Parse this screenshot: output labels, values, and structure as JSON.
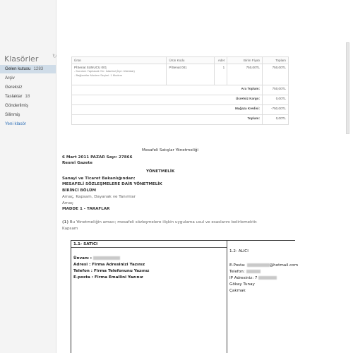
{
  "sidebar": {
    "title": "Klasörler",
    "refresh_icon": "refresh-icon",
    "folders": [
      {
        "label": "Gelen kutusu",
        "count": "1283",
        "selected": true
      },
      {
        "label": "Arşiv",
        "count": ""
      },
      {
        "label": "Gereksiz",
        "count": ""
      },
      {
        "label": "Taslaklar",
        "count": "18"
      },
      {
        "label": "Gönderilmiş",
        "count": ""
      },
      {
        "label": "Silinmiş",
        "count": ""
      }
    ],
    "new_folder": "Yeni klasör"
  },
  "order": {
    "headers": [
      "Ürün",
      "Ürün Kodu",
      "Adet",
      "Birim Fiyatı",
      "Toplam"
    ],
    "row": {
      "product": "PİSenat SUNUCU 001",
      "notes": [
        "- Kurulum Yapılacak Yer: İstanbul (İlçe: Üsküdar)",
        "- Bağlantılar Modem Seçimi: 1 Modem"
      ],
      "code": "PİSenat 001",
      "qty": "1",
      "unit_price": "750,00TL",
      "total": "750,00TL"
    },
    "summary": [
      {
        "label": "Ara Toplam:",
        "value": "750,00TL"
      },
      {
        "label": "Ücretsiz Kargo:",
        "value": "0,00TL"
      },
      {
        "label": "Mağaza Kredisi:",
        "value": "-750,00TL"
      },
      {
        "label": "Toplam:",
        "value": "0,00TL"
      }
    ]
  },
  "doc": {
    "title": "Mesafeli Satışlar Yönetmeliği",
    "date": "6 Mart 2011 PAZAR Sayı: 27866",
    "gazette": "Resmî Gazete",
    "heading": "YÖNETMELİK",
    "ministry": "Sanayi ve Ticaret Bakanlığından:",
    "regulation": "MESAFELİ SÖZLEŞMELERE DAİR YÖNETMELİK",
    "part": "BİRİNCİ BÖLÜM",
    "part_sub": "Amaç, Kapsam, Dayanak ve Tanımlar",
    "purpose": "Amaç",
    "article": "MADDE 1 - TARAFLAR",
    "para_num": "(1)",
    "para": "Bu Yönetmeliğin amacı; mesafeli sözleşmelere ilişkin uygulama usul ve esaslarını belirlemektir.",
    "scope": "Kapsam"
  },
  "parties": {
    "seller_title": "1.1- SATICI",
    "seller_name_label": "Ünvanı :",
    "seller_address": "Adresi : Firma Adresinizi Yazınız",
    "seller_phone": "Telefon : Firma Telefonunu Yazınız",
    "seller_email": "E-posta : Firma Emailini Yazınız",
    "buyer_title": "1.2- ALICI",
    "buyer_email_label": "E-Posta:",
    "buyer_email_tail": "@hotmail.com",
    "buyer_phone_label": "Telefon:",
    "buyer_ip_label": "IP Adresiniz: 7",
    "buyer_name": "Gökay Tunay",
    "buyer_district": "Çakmak"
  }
}
